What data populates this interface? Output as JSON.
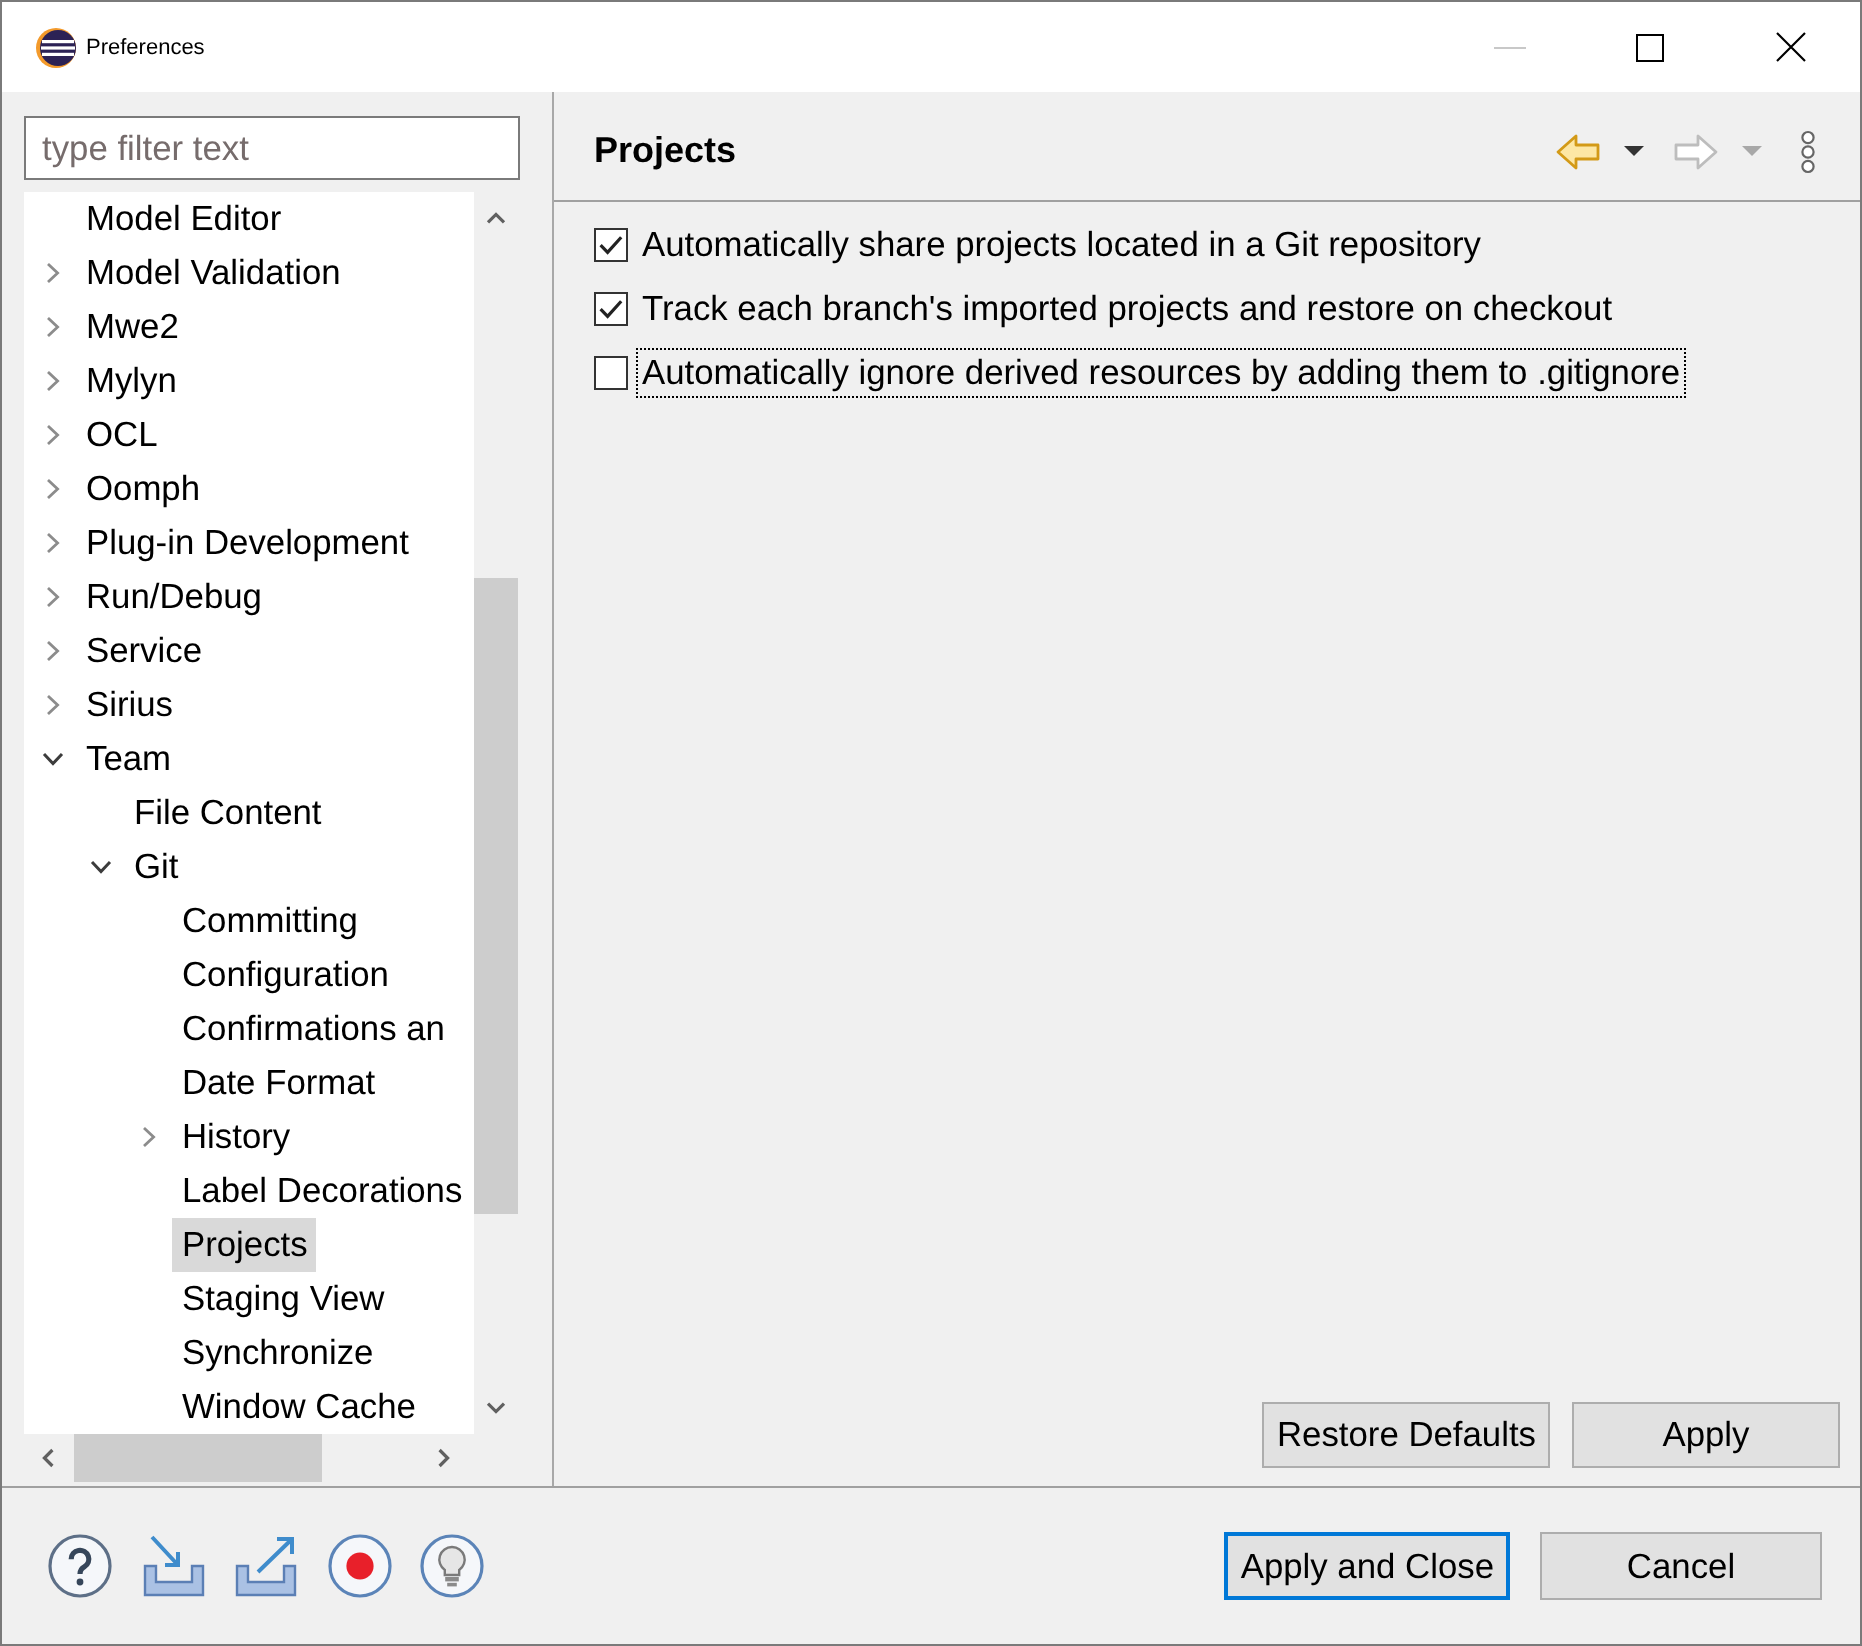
{
  "window": {
    "title": "Preferences",
    "minimize_disabled": true
  },
  "filter": {
    "placeholder": "type filter text"
  },
  "tree": [
    {
      "label": "Model Editor",
      "selected": false
    },
    {
      "label": "Model Validation",
      "expanded": false,
      "selected": false
    },
    {
      "label": "Mwe2",
      "expanded": false,
      "selected": false
    },
    {
      "label": "Mylyn",
      "expanded": false,
      "selected": false
    },
    {
      "label": "OCL",
      "expanded": false,
      "selected": false
    },
    {
      "label": "Oomph",
      "expanded": false,
      "selected": false
    },
    {
      "label": "Plug-in Development",
      "expanded": false,
      "selected": false
    },
    {
      "label": "Run/Debug",
      "expanded": false,
      "selected": false
    },
    {
      "label": "Service",
      "expanded": false,
      "selected": false
    },
    {
      "label": "Sirius",
      "expanded": false,
      "selected": false
    },
    {
      "label": "Team",
      "expanded": true,
      "selected": false,
      "children": [
        {
          "label": "File Content",
          "selected": false
        },
        {
          "label": "Git",
          "expanded": true,
          "selected": false,
          "children": [
            {
              "label": "Committing",
              "selected": false
            },
            {
              "label": "Configuration",
              "selected": false
            },
            {
              "label": "Confirmations an",
              "selected": false
            },
            {
              "label": "Date Format",
              "selected": false
            },
            {
              "label": "History",
              "expanded": false,
              "selected": false
            },
            {
              "label": "Label Decorations",
              "selected": false
            },
            {
              "label": "Projects",
              "selected": true
            },
            {
              "label": "Staging View",
              "selected": false
            },
            {
              "label": "Synchronize",
              "selected": false
            },
            {
              "label": "Window Cache",
              "selected": false
            }
          ]
        }
      ]
    }
  ],
  "page": {
    "title": "Projects",
    "toolbar": {
      "back_disabled": false,
      "forward_disabled": true
    },
    "options": [
      {
        "label": "Automatically share projects located in a Git repository",
        "checked": true,
        "focused": false
      },
      {
        "label": "Track each branch's imported projects and restore on checkout",
        "checked": true,
        "focused": false
      },
      {
        "label": "Automatically ignore derived resources by adding them to .gitignore",
        "checked": false,
        "focused": true
      }
    ],
    "buttons": [
      {
        "label": "Restore Defaults"
      },
      {
        "label": "Apply"
      }
    ]
  },
  "dialog_buttons": [
    {
      "label": "Apply and Close",
      "default": true
    },
    {
      "label": "Cancel",
      "default": false
    }
  ]
}
